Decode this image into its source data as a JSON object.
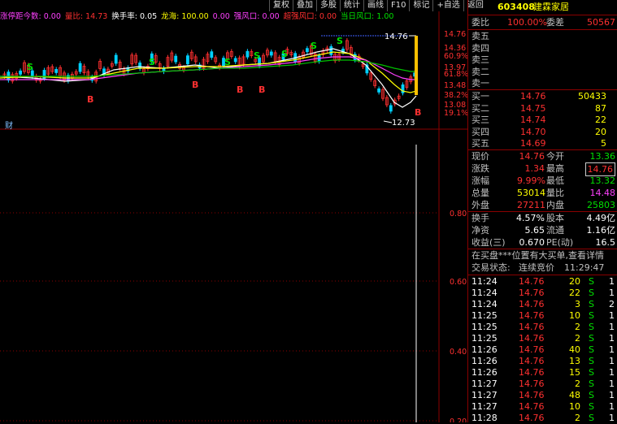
{
  "toolbar": [
    "复权",
    "叠加",
    "多股",
    "统计",
    "画线",
    "F10",
    "标记",
    "+自选",
    "返回"
  ],
  "indicator_line": [
    {
      "text": "涨停距今数: 0.00",
      "color": "#ff40ff"
    },
    {
      "text": "量比: 14.73",
      "color": "#ff3030"
    },
    {
      "text": "换手率: 0.05",
      "color": "#ffffff"
    },
    {
      "text": "龙海: 100.00",
      "color": "#ffff00"
    },
    {
      "text": "0.00",
      "color": "#ff40ff"
    },
    {
      "text": "强风口: 0.00",
      "color": "#ff40ff"
    },
    {
      "text": "超强风口: 0.00",
      "color": "#ff3030"
    },
    {
      "text": "当日风口: 1.00",
      "color": "#00e000"
    }
  ],
  "price_axis": [
    {
      "label": "14.76",
      "color": "#ff3030"
    },
    {
      "label": "14.36",
      "color": "#ff3030"
    },
    {
      "label": "60.9%",
      "color": "#ff3030"
    },
    {
      "label": "13.97",
      "color": "#ff3030"
    },
    {
      "label": "61.8%",
      "color": "#ff3030"
    },
    {
      "label": "13.48",
      "color": "#ff3030"
    },
    {
      "label": "38.2%",
      "color": "#ff3030"
    },
    {
      "label": "13.08",
      "color": "#ff3030"
    },
    {
      "label": "19.1%",
      "color": "#ff3030"
    }
  ],
  "chart_annotations": {
    "high": "14.76",
    "low": "12.73",
    "bottom_label": "财"
  },
  "signals": {
    "buy": "B",
    "sell": "S"
  },
  "volume_axis": [
    "0.80",
    "0.60",
    "0.40",
    "0.20"
  ],
  "panel": {
    "code": "603408",
    "name": "建霖家居",
    "weibi_label": "委比",
    "weibi_value": "100.00%",
    "weicha_label": "委差",
    "weicha_value": "50567",
    "asks": [
      {
        "label": "卖五",
        "price": "",
        "vol": ""
      },
      {
        "label": "卖四",
        "price": "",
        "vol": ""
      },
      {
        "label": "卖三",
        "price": "",
        "vol": ""
      },
      {
        "label": "卖二",
        "price": "",
        "vol": ""
      },
      {
        "label": "卖一",
        "price": "",
        "vol": ""
      }
    ],
    "bids": [
      {
        "label": "买一",
        "price": "14.76",
        "vol": "50433"
      },
      {
        "label": "买二",
        "price": "14.75",
        "vol": "87"
      },
      {
        "label": "买三",
        "price": "14.74",
        "vol": "22"
      },
      {
        "label": "买四",
        "price": "14.70",
        "vol": "20"
      },
      {
        "label": "买五",
        "price": "14.69",
        "vol": "5"
      }
    ],
    "stats": [
      {
        "l1": "现价",
        "v1": "14.76",
        "c1": "#ff3030",
        "l2": "今开",
        "v2": "13.36",
        "c2": "#00e000"
      },
      {
        "l1": "涨跌",
        "v1": "1.34",
        "c1": "#ff3030",
        "l2": "最高",
        "v2": "14.76",
        "c2": "#ff3030"
      },
      {
        "l1": "涨幅",
        "v1": "9.99%",
        "c1": "#ff3030",
        "l2": "最低",
        "v2": "13.32",
        "c2": "#00e000"
      },
      {
        "l1": "总量",
        "v1": "53014",
        "c1": "#ffff00",
        "l2": "量比",
        "v2": "14.48",
        "c2": "#ff40ff"
      },
      {
        "l1": "外盘",
        "v1": "27211",
        "c1": "#ff3030",
        "l2": "内盘",
        "v2": "25803",
        "c2": "#00e000"
      }
    ],
    "stats2": [
      {
        "l1": "换手",
        "v1": "4.57%",
        "l2": "股本",
        "v2": "4.49亿"
      },
      {
        "l1": "净资",
        "v1": "5.65",
        "l2": "流通",
        "v2": "1.16亿"
      },
      {
        "l1": "收益(三)",
        "v1": "0.670",
        "l2": "PE(动)",
        "v2": "16.5"
      }
    ],
    "notice": "在买盘***位置有大买单,查看详情",
    "trade_status_label": "交易状态:",
    "trade_status": "连续竞价",
    "trade_time": "11:29:47",
    "ticks": [
      {
        "t": "11:24",
        "p": "14.76",
        "v": "20",
        "s": "S",
        "n": "1"
      },
      {
        "t": "11:24",
        "p": "14.76",
        "v": "22",
        "s": "S",
        "n": "1"
      },
      {
        "t": "11:24",
        "p": "14.76",
        "v": "3",
        "s": "S",
        "n": "2"
      },
      {
        "t": "11:25",
        "p": "14.76",
        "v": "10",
        "s": "S",
        "n": "1"
      },
      {
        "t": "11:25",
        "p": "14.76",
        "v": "2",
        "s": "S",
        "n": "1"
      },
      {
        "t": "11:25",
        "p": "14.76",
        "v": "2",
        "s": "S",
        "n": "1"
      },
      {
        "t": "11:26",
        "p": "14.76",
        "v": "40",
        "s": "S",
        "n": "1"
      },
      {
        "t": "11:26",
        "p": "14.76",
        "v": "13",
        "s": "S",
        "n": "1"
      },
      {
        "t": "11:26",
        "p": "14.76",
        "v": "15",
        "s": "S",
        "n": "1"
      },
      {
        "t": "11:27",
        "p": "14.76",
        "v": "2",
        "s": "S",
        "n": "1"
      },
      {
        "t": "11:27",
        "p": "14.76",
        "v": "48",
        "s": "S",
        "n": "1"
      },
      {
        "t": "11:27",
        "p": "14.76",
        "v": "10",
        "s": "S",
        "n": "1"
      },
      {
        "t": "11:28",
        "p": "14.76",
        "v": "2",
        "s": "S",
        "n": "1"
      }
    ],
    "colors": {
      "up": "#ff3030",
      "down": "#00e000",
      "border": "#8b0000",
      "flat": "#c0c0c0"
    }
  }
}
